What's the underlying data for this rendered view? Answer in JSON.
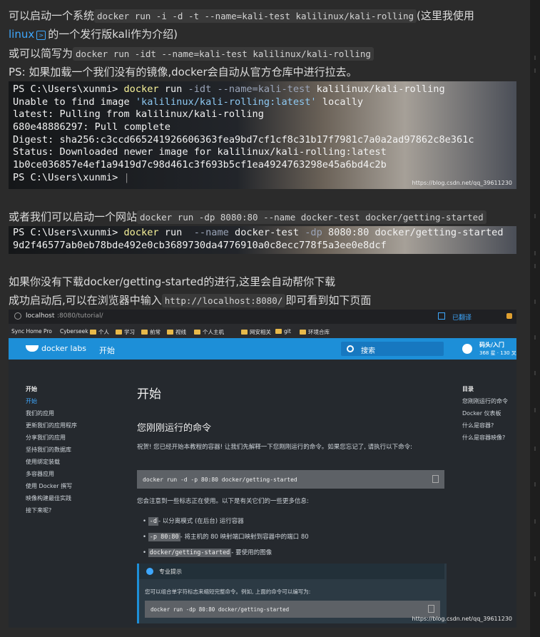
{
  "intro": {
    "line1_prefix": "可以启动一个系统",
    "line1_code": "docker run -i -d -t --name=kali-test kalilinux/kali-rolling",
    "line1_suffix": "(这里我使用",
    "line2_link": "linux",
    "line2_rest": "的一个发行版kali作为介绍)",
    "line3_prefix": "或可以简写为",
    "line3_code": "docker run -idt --name=kali-test kalilinux/kali-rolling",
    "line4": "PS: 如果加载一个我们没有的镜像,docker会自动从官方仓库中进行拉去。"
  },
  "terminal1": {
    "prompt": "PS C:\\Users\\xunmi> ",
    "cmd": "docker",
    "args1": " run ",
    "flags": "-idt --name=kali-test",
    "args2": " kalilinux/kali-rolling",
    "out1_a": "Unable to find image ",
    "out1_str": "'kalilinux/kali-rolling:latest'",
    "out1_b": " locally",
    "out2": "latest: Pulling from kalilinux/kali-rolling",
    "out3": "680e48886297: Pull complete",
    "out4": "Digest: sha256:c3ccd665241926606363fea9bd7cf1cf8c31b17f7981c7a0a2ad97862c8e361c",
    "out5": "Status: Downloaded newer image for kalilinux/kali-rolling:latest",
    "out6": "1b0ce036857e4ef1a9419d7c98d461c3f693b5cf1ea4924763298e45a6bd4c2b",
    "prompt_end": "PS C:\\Users\\xunmi> ",
    "watermark": "https://blog.csdn.net/qq_39611230"
  },
  "mid": {
    "prefix": "或者我们可以启动一个网站",
    "code": "docker run -dp 8080:80 --name docker-test docker/getting-started"
  },
  "terminal2": {
    "prompt": "PS C:\\Users\\xunmi> ",
    "cmd": "docker",
    "args1": " run  ",
    "flag1": "--name",
    "arg_name": " docker-test ",
    "flag2": "-dp",
    "args2": " 8080:80 docker/getting-started",
    "out1": "9d2f46577ab0eb78bde492e0cb3689730da4776910a0c8ecc778f5a3ee0e8dcf"
  },
  "after": {
    "line1": "如果你没有下载docker/getting-started的进行,这里会自动帮你下载",
    "line2_prefix": "成功启动后,可以在浏览器中输入",
    "line2_code": "http://localhost:8080/",
    "line2_suffix": "即可看到如下页面"
  },
  "browser": {
    "url_host": "localhost",
    "url_path": ":8080/tutorial/",
    "translated": "已翻译",
    "bookmarks": [
      "Sync Home Pro",
      "Cyberseek",
      "个人",
      "学习",
      "前常",
      "视线",
      "个人主机",
      "网安相关",
      "git",
      "环境合库"
    ],
    "brand": "docker labs",
    "nav_start": "开始",
    "search_placeholder": "搜索",
    "repo_label": "码头/入门",
    "repo_stats": "368 星 · 130 叉",
    "sidebar": [
      "开始",
      "开始",
      "我们的应用",
      "更新我们的应用程序",
      "分享我们的应用",
      "坚持我们的数据库",
      "使用绑定装载",
      "多容器应用",
      "使用 Docker 撰写",
      "映像构建最佳实践",
      "接下来呢?"
    ],
    "page_title": "开始",
    "section_title": "您刚刚运行的命令",
    "para1": "祝贺! 您已经开始本教程的容器! 让我们先解释一下您刚刚运行的命令。如果您忘记了, 请执行以下命令:",
    "code1": "docker run -d -p 80:80 docker/getting-started",
    "para2": "您会注意到一些标志正在使用。以下是有关它们的一些更多信息:",
    "bullets": [
      {
        "code": "-d",
        "text": "- 以分离模式 (在后台) 运行容器"
      },
      {
        "code": "-p 80:80",
        "text": "- 将主机的 80 映射端口映射到容器中的端口 80"
      },
      {
        "code": "docker/getting-started",
        "text": "- 要使用的图像"
      }
    ],
    "tip_title": "专业提示",
    "tip_text": "您可以组合单字符标志来缩短完整命令。例如, 上面的命令可以编写为:",
    "tip_code": "docker run -dp 80:80 docker/getting-started",
    "toc_title": "目录",
    "toc": [
      "您刚刚运行的命令",
      "Docker 仪表板",
      "什么是容器?",
      "什么是容器映像?"
    ],
    "watermark": "https://blog.csdn.net/qq_39611230"
  }
}
